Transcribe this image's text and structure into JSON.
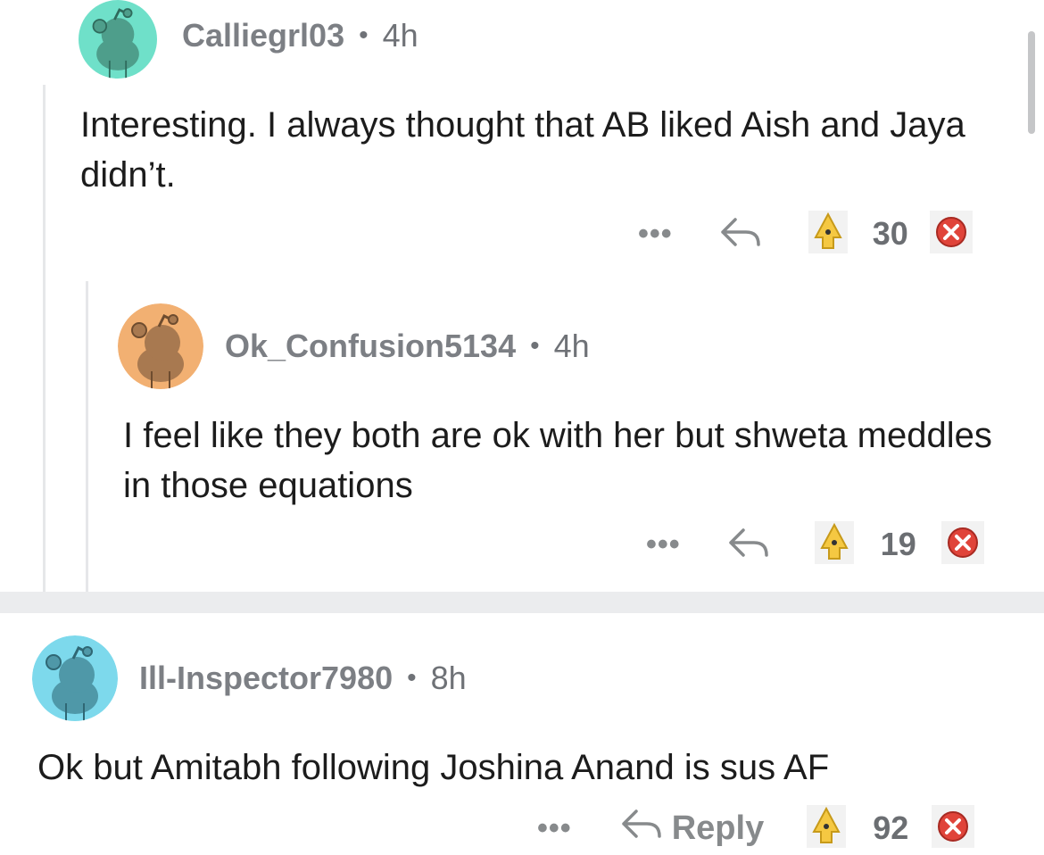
{
  "comments": [
    {
      "username": "Calliegrl03",
      "separator": "•",
      "time": "4h",
      "text": "Interesting. I always thought that AB liked Aish and Jaya didn’t.",
      "more": "•••",
      "votes": "30",
      "avatar_color": "#6fe0c9"
    },
    {
      "username": "Ok_Confusion5134",
      "separator": "•",
      "time": "4h",
      "text": "I feel like they both are ok with her but shweta meddles in those equations",
      "more": "•••",
      "votes": "19",
      "avatar_color": "#f2b072"
    },
    {
      "username": "Ill-Inspector7980",
      "separator": "•",
      "time": "8h",
      "text": "Ok but Amitabh following Joshina Anand is sus AF",
      "more": "•••",
      "reply_label": "Reply",
      "votes": "92",
      "avatar_color": "#7dd9ec"
    }
  ],
  "icons": {
    "upvote": "upvote-icon",
    "downvote": "downvote-icon",
    "reply": "reply-arrow-icon",
    "more": "more-options-icon"
  },
  "colors": {
    "upvote_fill": "#f5c842",
    "downvote_fill": "#e0443a",
    "divider": "#ebecee"
  }
}
